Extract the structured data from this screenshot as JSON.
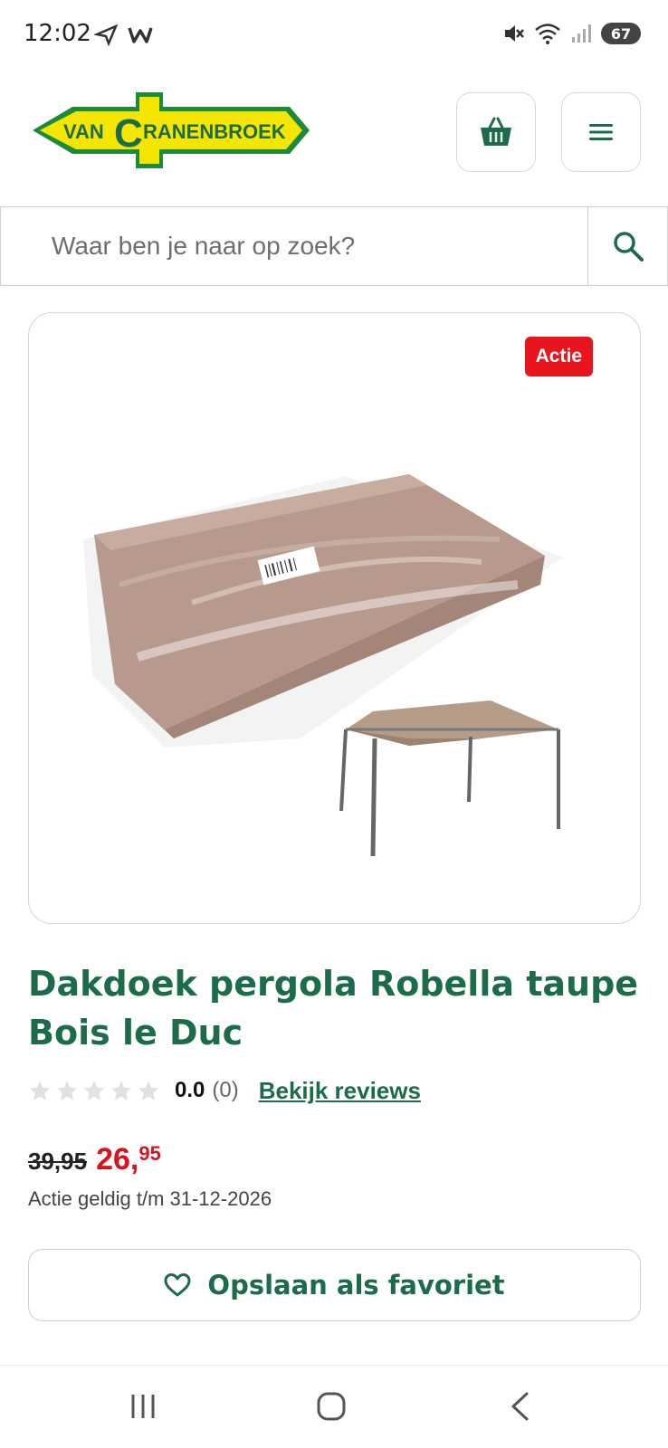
{
  "status_bar": {
    "time": "12:02",
    "battery": "67"
  },
  "header": {
    "logo_text": "VANCRANENBROEK",
    "cart_icon": "basket-icon",
    "menu_icon": "hamburger-menu-icon"
  },
  "search": {
    "placeholder": "Waar ben je naar op zoek?",
    "value": "",
    "icon": "search-icon"
  },
  "product": {
    "badge": "Actie",
    "title": "Dakdoek pergola Robella taupe Bois le Duc",
    "rating": {
      "stars_filled": 0,
      "stars_total": 5,
      "score": "0.0",
      "count": "(0)",
      "reviews_link": "Bekijk reviews"
    },
    "price": {
      "old": "39,95",
      "new_whole": "26,",
      "new_decimal": "95"
    },
    "validity": "Actie geldig t/m 31-12-2026",
    "favorite_button": "Opslaan als favoriet"
  },
  "colors": {
    "brand_green": "#1c6b4b",
    "logo_yellow": "#f5e600",
    "sale_red": "#d7141d"
  }
}
